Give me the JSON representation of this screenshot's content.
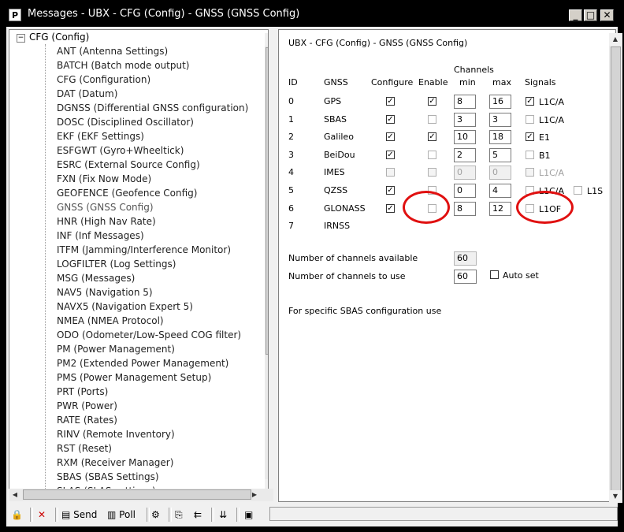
{
  "window": {
    "title": "Messages - UBX - CFG (Config) - GNSS (GNSS Config)",
    "app_icon": "P",
    "minimize": "_",
    "maximize": "□",
    "close": "✕"
  },
  "tree": {
    "root": "CFG (Config)",
    "items": [
      "ANT (Antenna Settings)",
      "BATCH (Batch mode output)",
      "CFG (Configuration)",
      "DAT (Datum)",
      "DGNSS (Differential GNSS configuration)",
      "DOSC (Disciplined Oscillator)",
      "EKF (EKF Settings)",
      "ESFGWT (Gyro+Wheeltick)",
      "ESRC (External Source Config)",
      "FXN (Fix Now Mode)",
      "GEOFENCE (Geofence Config)",
      "GNSS (GNSS Config)",
      "HNR (High Nav Rate)",
      "INF (Inf Messages)",
      "ITFM (Jamming/Interference Monitor)",
      "LOGFILTER (Log Settings)",
      "MSG (Messages)",
      "NAV5 (Navigation 5)",
      "NAVX5 (Navigation Expert 5)",
      "NMEA (NMEA Protocol)",
      "ODO (Odometer/Low-Speed COG filter)",
      "PM (Power Management)",
      "PM2 (Extended Power Management)",
      "PMS (Power Management Setup)",
      "PRT (Ports)",
      "PWR (Power)",
      "RATE (Rates)",
      "RINV (Remote Inventory)",
      "RST (Reset)",
      "RXM (Receiver Manager)",
      "SBAS (SBAS Settings)",
      "SLAS (SLAS settings)"
    ],
    "selected": "GNSS (GNSS Config)"
  },
  "panel": {
    "title": "UBX - CFG (Config) - GNSS (GNSS Config)",
    "headers": {
      "channels": "Channels",
      "id": "ID",
      "gnss": "GNSS",
      "configure": "Configure",
      "enable": "Enable",
      "min": "min",
      "max": "max",
      "signals": "Signals"
    },
    "rows": [
      {
        "id": "0",
        "gnss": "GPS",
        "configure": true,
        "enable": true,
        "min": "8",
        "max": "16",
        "signal": "L1C/A",
        "signal_checked": true,
        "enabled": true
      },
      {
        "id": "1",
        "gnss": "SBAS",
        "configure": true,
        "enable": false,
        "min": "3",
        "max": "3",
        "signal": "L1C/A",
        "signal_checked": false,
        "enabled": true
      },
      {
        "id": "2",
        "gnss": "Galileo",
        "configure": true,
        "enable": true,
        "min": "10",
        "max": "18",
        "signal": "E1",
        "signal_checked": true,
        "enabled": true
      },
      {
        "id": "3",
        "gnss": "BeiDou",
        "configure": true,
        "enable": false,
        "min": "2",
        "max": "5",
        "signal": "B1",
        "signal_checked": false,
        "enabled": true
      },
      {
        "id": "4",
        "gnss": "IMES",
        "configure": false,
        "enable": false,
        "min": "0",
        "max": "0",
        "signal": "L1C/A",
        "signal_checked": false,
        "enabled": false
      },
      {
        "id": "5",
        "gnss": "QZSS",
        "configure": true,
        "enable": false,
        "min": "0",
        "max": "4",
        "signal": "L1C/A",
        "signal_checked": false,
        "enabled": true,
        "signal2": "L1S"
      },
      {
        "id": "6",
        "gnss": "GLONASS",
        "configure": true,
        "enable": false,
        "min": "8",
        "max": "12",
        "signal": "L1OF",
        "signal_checked": false,
        "enabled": true
      },
      {
        "id": "7",
        "gnss": "IRNSS"
      }
    ],
    "channels_available_label": "Number of channels available",
    "channels_available": "60",
    "channels_to_use_label": "Number of channels to use",
    "channels_to_use": "60",
    "auto_set_label": "Auto set",
    "sbas_note": "For specific SBAS configuration use"
  },
  "toolbar": {
    "send_label": "Send",
    "poll_label": "Poll"
  },
  "colors": {
    "annotation_ring": "#e01010",
    "titlebar": "#000000"
  }
}
